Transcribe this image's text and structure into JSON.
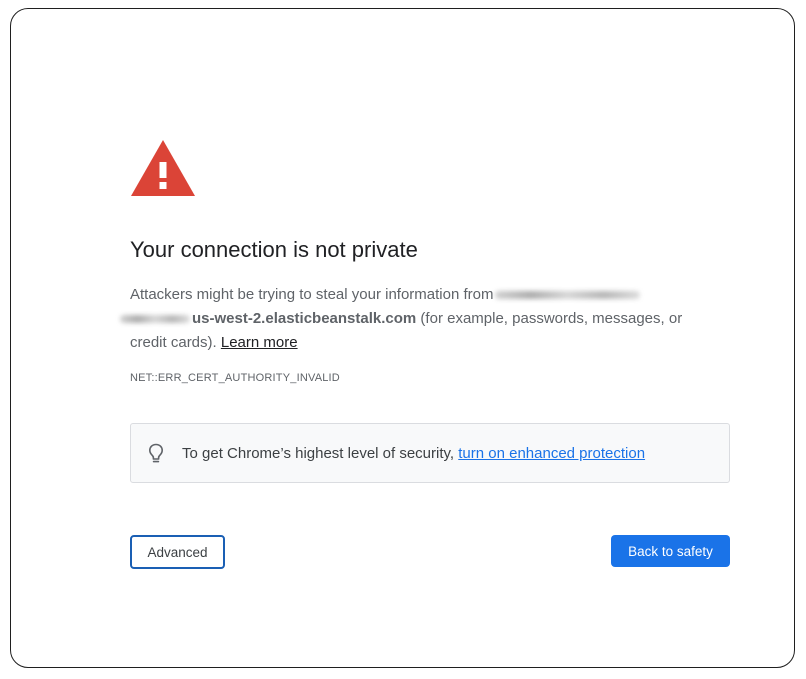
{
  "interstitial": {
    "title": "Your connection is not private",
    "description_prefix": "Attackers might be trying to steal your information from",
    "hostname_visible": "us-west-2.elasticbeanstalk.com",
    "description_suffix": " (for example, passwords, messages, or credit cards). ",
    "learn_more": "Learn more",
    "error_code": "NET::ERR_CERT_AUTHORITY_INVALID",
    "warning_icon": "warning-triangle-icon",
    "warning_color": "#db4437"
  },
  "promo": {
    "icon": "lightbulb-icon",
    "text": "To get Chrome’s highest level of security, ",
    "link": "turn on enhanced protection",
    "link_color": "#1a73e8"
  },
  "buttons": {
    "advanced": "Advanced",
    "back_to_safety": "Back to safety",
    "primary_color": "#1a73e8"
  }
}
